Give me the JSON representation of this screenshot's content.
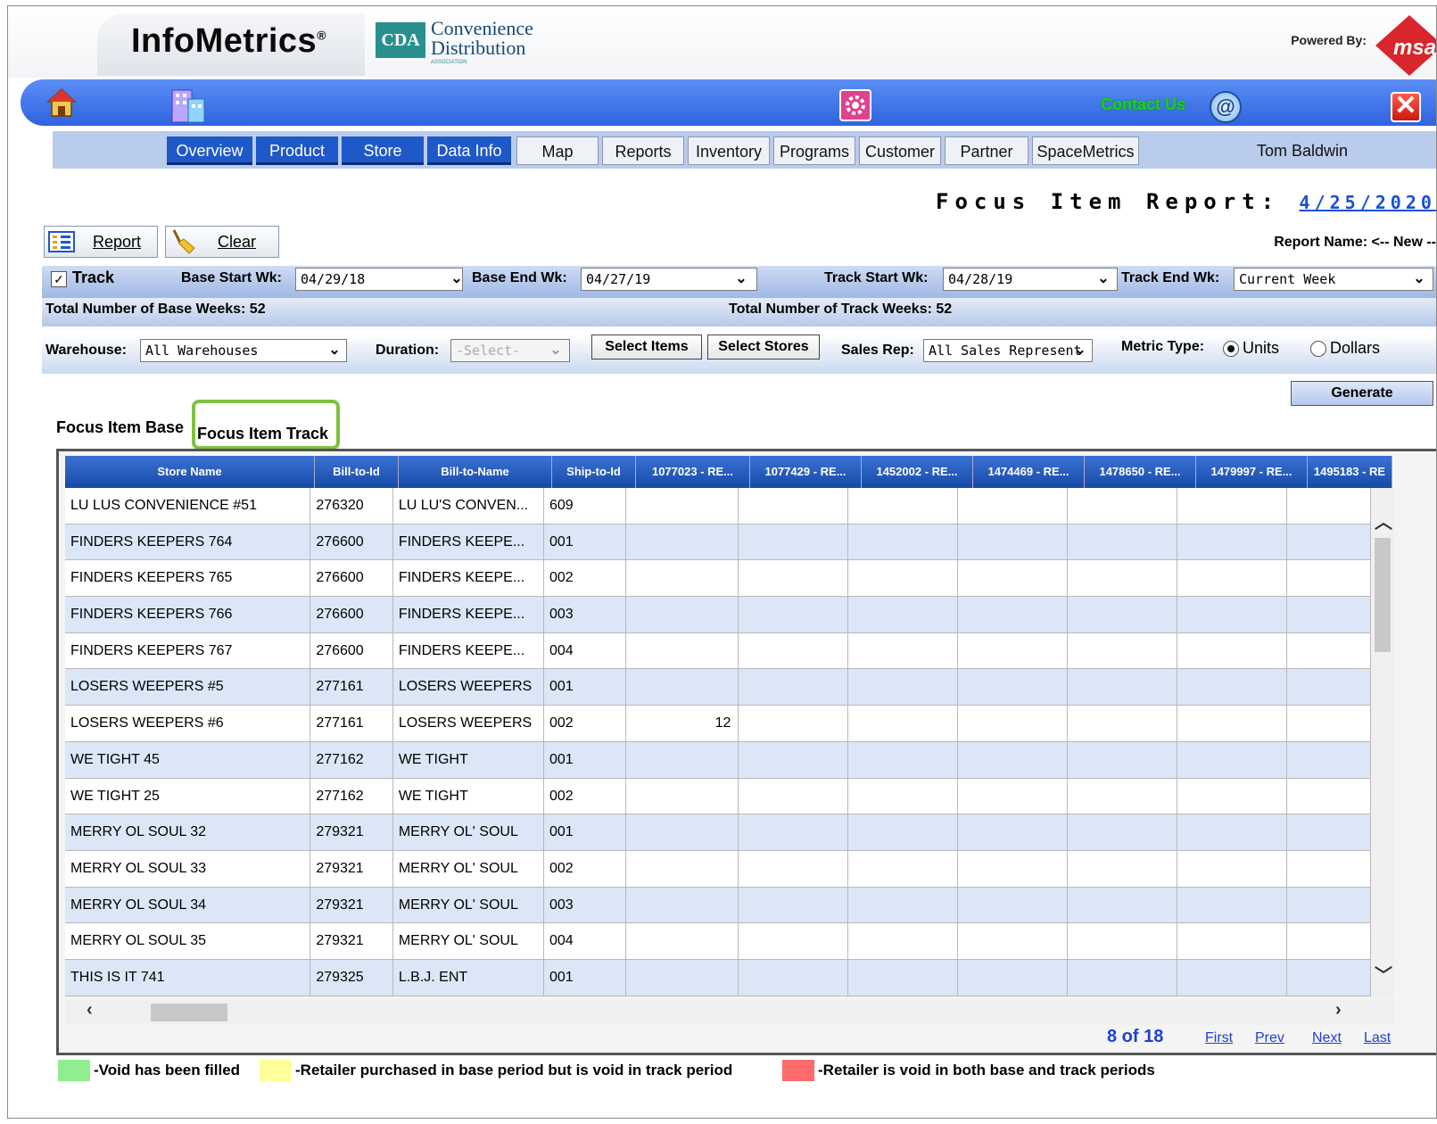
{
  "brand": {
    "title": "InfoMetrics",
    "registered": "®",
    "cda_box": "CDA",
    "cda_line1": "Convenience",
    "cda_line2": "Distribution",
    "cda_sub": "ASSOCIATION",
    "powered_by": "Powered By:",
    "msa_logo": "msa"
  },
  "toolbar": {
    "contact_us": "Contact Us",
    "at": "@",
    "close": "✕"
  },
  "nav_tabs": [
    "Overview",
    "Product",
    "Store",
    "Data Info",
    "Map",
    "Reports",
    "Inventory",
    "Programs",
    "Customer",
    "Partner",
    "SpaceMetrics"
  ],
  "user": "Tom Baldwin",
  "report": {
    "title": "Focus Item Report:",
    "date": "4/25/2020",
    "report_btn": "Report",
    "clear_btn": "Clear",
    "report_name": "Report Name: <-- New --"
  },
  "weeks": {
    "track_label": "Track",
    "base_start_label": "Base Start Wk:",
    "base_start_value": "04/29/18",
    "base_end_label": "Base End Wk:",
    "base_end_value": "04/27/19",
    "track_start_label": "Track Start Wk:",
    "track_start_value": "04/28/19",
    "track_end_label": "Track End Wk:",
    "track_end_value": "Current Week",
    "total_base": "Total Number of Base Weeks: 52",
    "total_track": "Total Number of Track Weeks: 52"
  },
  "filters": {
    "warehouse_label": "Warehouse:",
    "warehouse_value": "All Warehouses",
    "duration_label": "Duration:",
    "duration_value": "-Select-",
    "select_items": "Select Items",
    "select_stores": "Select Stores",
    "sales_rep_label": "Sales Rep:",
    "sales_rep_value": "All Sales Represent",
    "metric_label": "Metric Type:",
    "metric_units": "Units",
    "metric_dollars": "Dollars",
    "metric_selected": "Units",
    "generate": "Generate"
  },
  "tabs": {
    "base": "Focus Item Base",
    "track": "Focus Item Track",
    "active": "Focus Item Track"
  },
  "grid": {
    "columns": [
      "Store Name",
      "Bill-to-Id",
      "Bill-to-Name",
      "Ship-to-Id",
      "1077023 - RE...",
      "1077429 - RE...",
      "1452002 - RE...",
      "1474469 - RE...",
      "1478650 - RE...",
      "1479997 - RE...",
      "1495183 - RE"
    ],
    "rows": [
      [
        "LU LUS CONVENIENCE #51",
        "276320",
        "LU LU'S CONVEN...",
        "609",
        ""
      ],
      [
        "FINDERS KEEPERS 764",
        "276600",
        "FINDERS KEEPE...",
        "001",
        ""
      ],
      [
        "FINDERS KEEPERS 765",
        "276600",
        "FINDERS KEEPE...",
        "002",
        ""
      ],
      [
        "FINDERS KEEPERS 766",
        "276600",
        "FINDERS KEEPE...",
        "003",
        ""
      ],
      [
        "FINDERS KEEPERS 767",
        "276600",
        "FINDERS KEEPE...",
        "004",
        ""
      ],
      [
        "LOSERS WEEPERS #5",
        "277161",
        "LOSERS WEEPERS",
        "001",
        ""
      ],
      [
        "LOSERS WEEPERS #6",
        "277161",
        "LOSERS WEEPERS",
        "002",
        "12"
      ],
      [
        "WE TIGHT 45",
        "277162",
        "WE TIGHT",
        "001",
        ""
      ],
      [
        "WE TIGHT 25",
        "277162",
        "WE TIGHT",
        "002",
        ""
      ],
      [
        "MERRY OL SOUL 32",
        "279321",
        "MERRY OL' SOUL",
        "001",
        ""
      ],
      [
        "MERRY OL SOUL 33",
        "279321",
        "MERRY OL' SOUL",
        "002",
        ""
      ],
      [
        "MERRY OL SOUL 34",
        "279321",
        "MERRY OL' SOUL",
        "003",
        ""
      ],
      [
        "MERRY OL SOUL 35",
        "279321",
        "MERRY OL' SOUL",
        "004",
        ""
      ],
      [
        "THIS IS IT 741",
        "279325",
        "L.B.J. ENT",
        "001",
        ""
      ]
    ]
  },
  "pager": {
    "count": "8 of 18",
    "first": "First",
    "prev": "Prev",
    "next": "Next",
    "last": "Last"
  },
  "legend": [
    {
      "color": "#90ee90",
      "text": "-Void has been filled"
    },
    {
      "color": "#ffff99",
      "text": "-Retailer purchased in base period but is void in track period"
    },
    {
      "color": "#ff6b6b",
      "text": "-Retailer is void in both base and track periods"
    }
  ],
  "icons": {
    "home": "home-icon",
    "building": "building-icon",
    "settings": "gear-icon",
    "report": "report-grid-icon",
    "clear": "broom-icon"
  }
}
